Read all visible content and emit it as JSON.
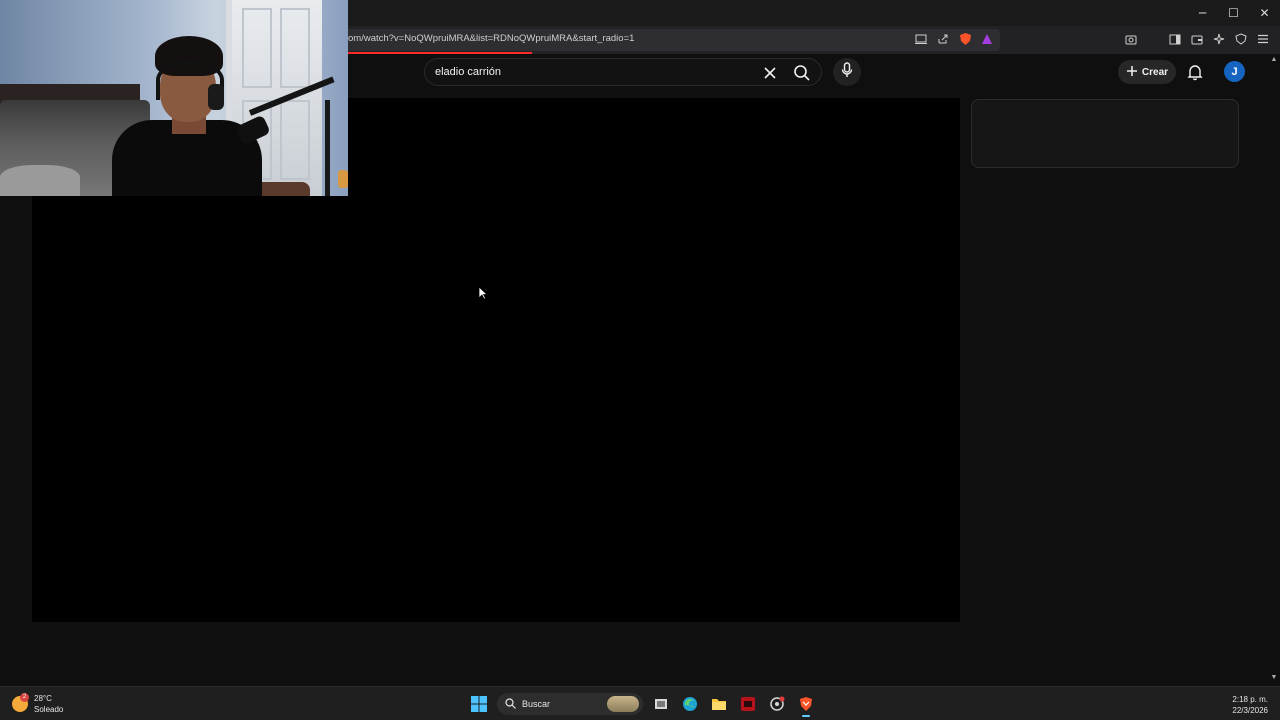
{
  "browser": {
    "url": "om/watch?v=NoQWpruiMRA&list=RDNoQWpruiMRA&start_radio=1",
    "window_controls": {
      "minimize": "─",
      "maximize": "☐",
      "close": "✕"
    }
  },
  "youtube": {
    "search": {
      "query": "eladio carrión"
    },
    "create_label": "Crear",
    "avatar_initial": "J"
  },
  "taskbar": {
    "weather": {
      "temp": "28°C",
      "condition": "Soleado",
      "badge": "2"
    },
    "search_label": "Buscar",
    "clock": {
      "time": "2:18 p. m.",
      "date": "22/3/2026"
    }
  },
  "colors": {
    "background": "#0f0f0f",
    "accent_red": "#ff2b2b",
    "avatar": "#1565c0"
  }
}
